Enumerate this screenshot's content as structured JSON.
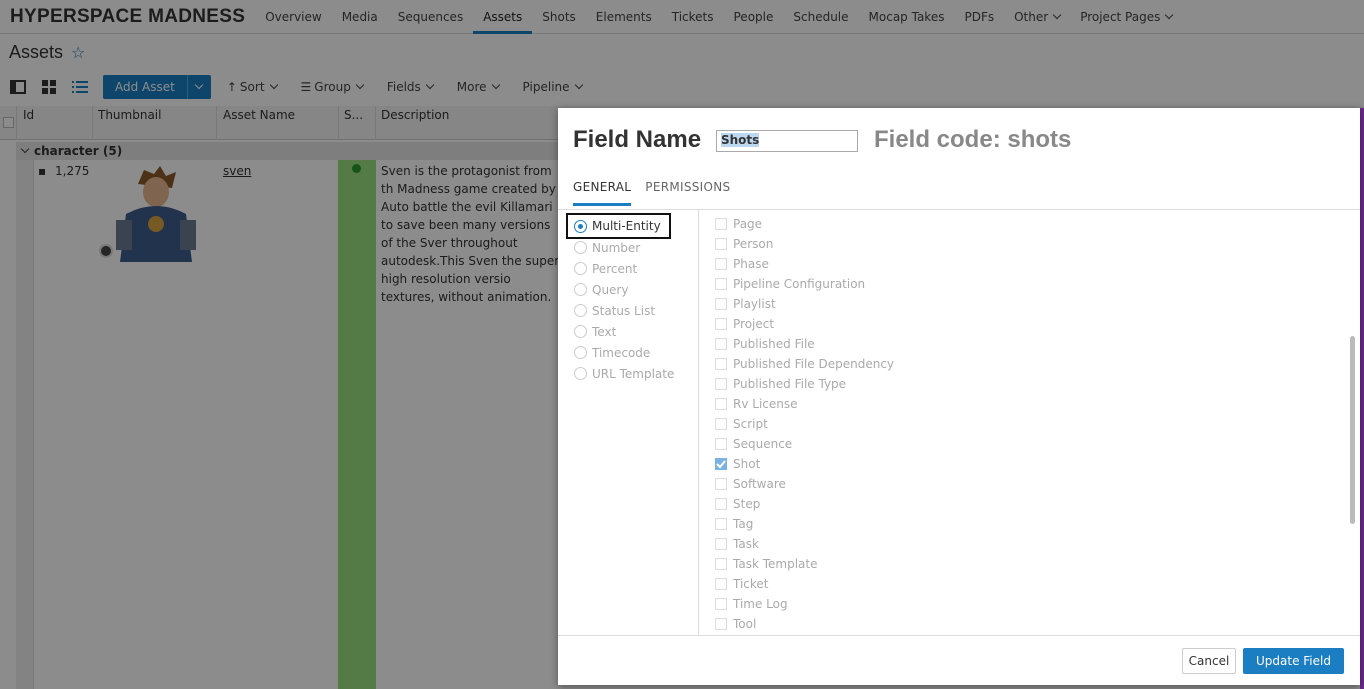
{
  "nav": {
    "brand": "HYPERSPACE MADNESS",
    "items": [
      {
        "label": "Overview"
      },
      {
        "label": "Media"
      },
      {
        "label": "Sequences"
      },
      {
        "label": "Assets",
        "active": true
      },
      {
        "label": "Shots"
      },
      {
        "label": "Elements"
      },
      {
        "label": "Tickets"
      },
      {
        "label": "People"
      },
      {
        "label": "Schedule"
      },
      {
        "label": "Mocap Takes"
      },
      {
        "label": "PDFs"
      },
      {
        "label": "Other",
        "dropdown": true
      },
      {
        "label": "Project Pages",
        "dropdown": true
      }
    ]
  },
  "page": {
    "title": "Assets"
  },
  "toolbar": {
    "add_asset": "Add Asset",
    "sort": "Sort",
    "group": "Group",
    "fields": "Fields",
    "more": "More",
    "pipeline": "Pipeline"
  },
  "grid": {
    "columns": [
      "Id",
      "Thumbnail",
      "Asset Name",
      "S...",
      "Description"
    ],
    "group_label": "character (5)",
    "row": {
      "id": "1,275",
      "asset_name": "sven",
      "description": "Sven is the protagonist from th Madness game created by Auto battle the evil Killamari to save been many versions of the Sver throughout autodesk.This Sven the super high resolution versio textures, without animation."
    }
  },
  "dialog": {
    "title": "Field Name",
    "field_value": "Shots",
    "field_code": "Field code: shots",
    "tabs": [
      "GENERAL",
      "PERMISSIONS"
    ],
    "types": [
      "Multi-Entity",
      "Number",
      "Percent",
      "Query",
      "Status List",
      "Text",
      "Timecode",
      "URL Template"
    ],
    "selected_type": "Multi-Entity",
    "entities": [
      {
        "label": "Page",
        "checked": false
      },
      {
        "label": "Person",
        "checked": false
      },
      {
        "label": "Phase",
        "checked": false
      },
      {
        "label": "Pipeline Configuration",
        "checked": false
      },
      {
        "label": "Playlist",
        "checked": false
      },
      {
        "label": "Project",
        "checked": false
      },
      {
        "label": "Published File",
        "checked": false
      },
      {
        "label": "Published File Dependency",
        "checked": false
      },
      {
        "label": "Published File Type",
        "checked": false
      },
      {
        "label": "Rv License",
        "checked": false
      },
      {
        "label": "Script",
        "checked": false
      },
      {
        "label": "Sequence",
        "checked": false
      },
      {
        "label": "Shot",
        "checked": true
      },
      {
        "label": "Software",
        "checked": false
      },
      {
        "label": "Step",
        "checked": false
      },
      {
        "label": "Tag",
        "checked": false
      },
      {
        "label": "Task",
        "checked": false
      },
      {
        "label": "Task Template",
        "checked": false
      },
      {
        "label": "Ticket",
        "checked": false
      },
      {
        "label": "Time Log",
        "checked": false
      },
      {
        "label": "Tool",
        "checked": false
      }
    ],
    "cancel": "Cancel",
    "update": "Update Field"
  }
}
